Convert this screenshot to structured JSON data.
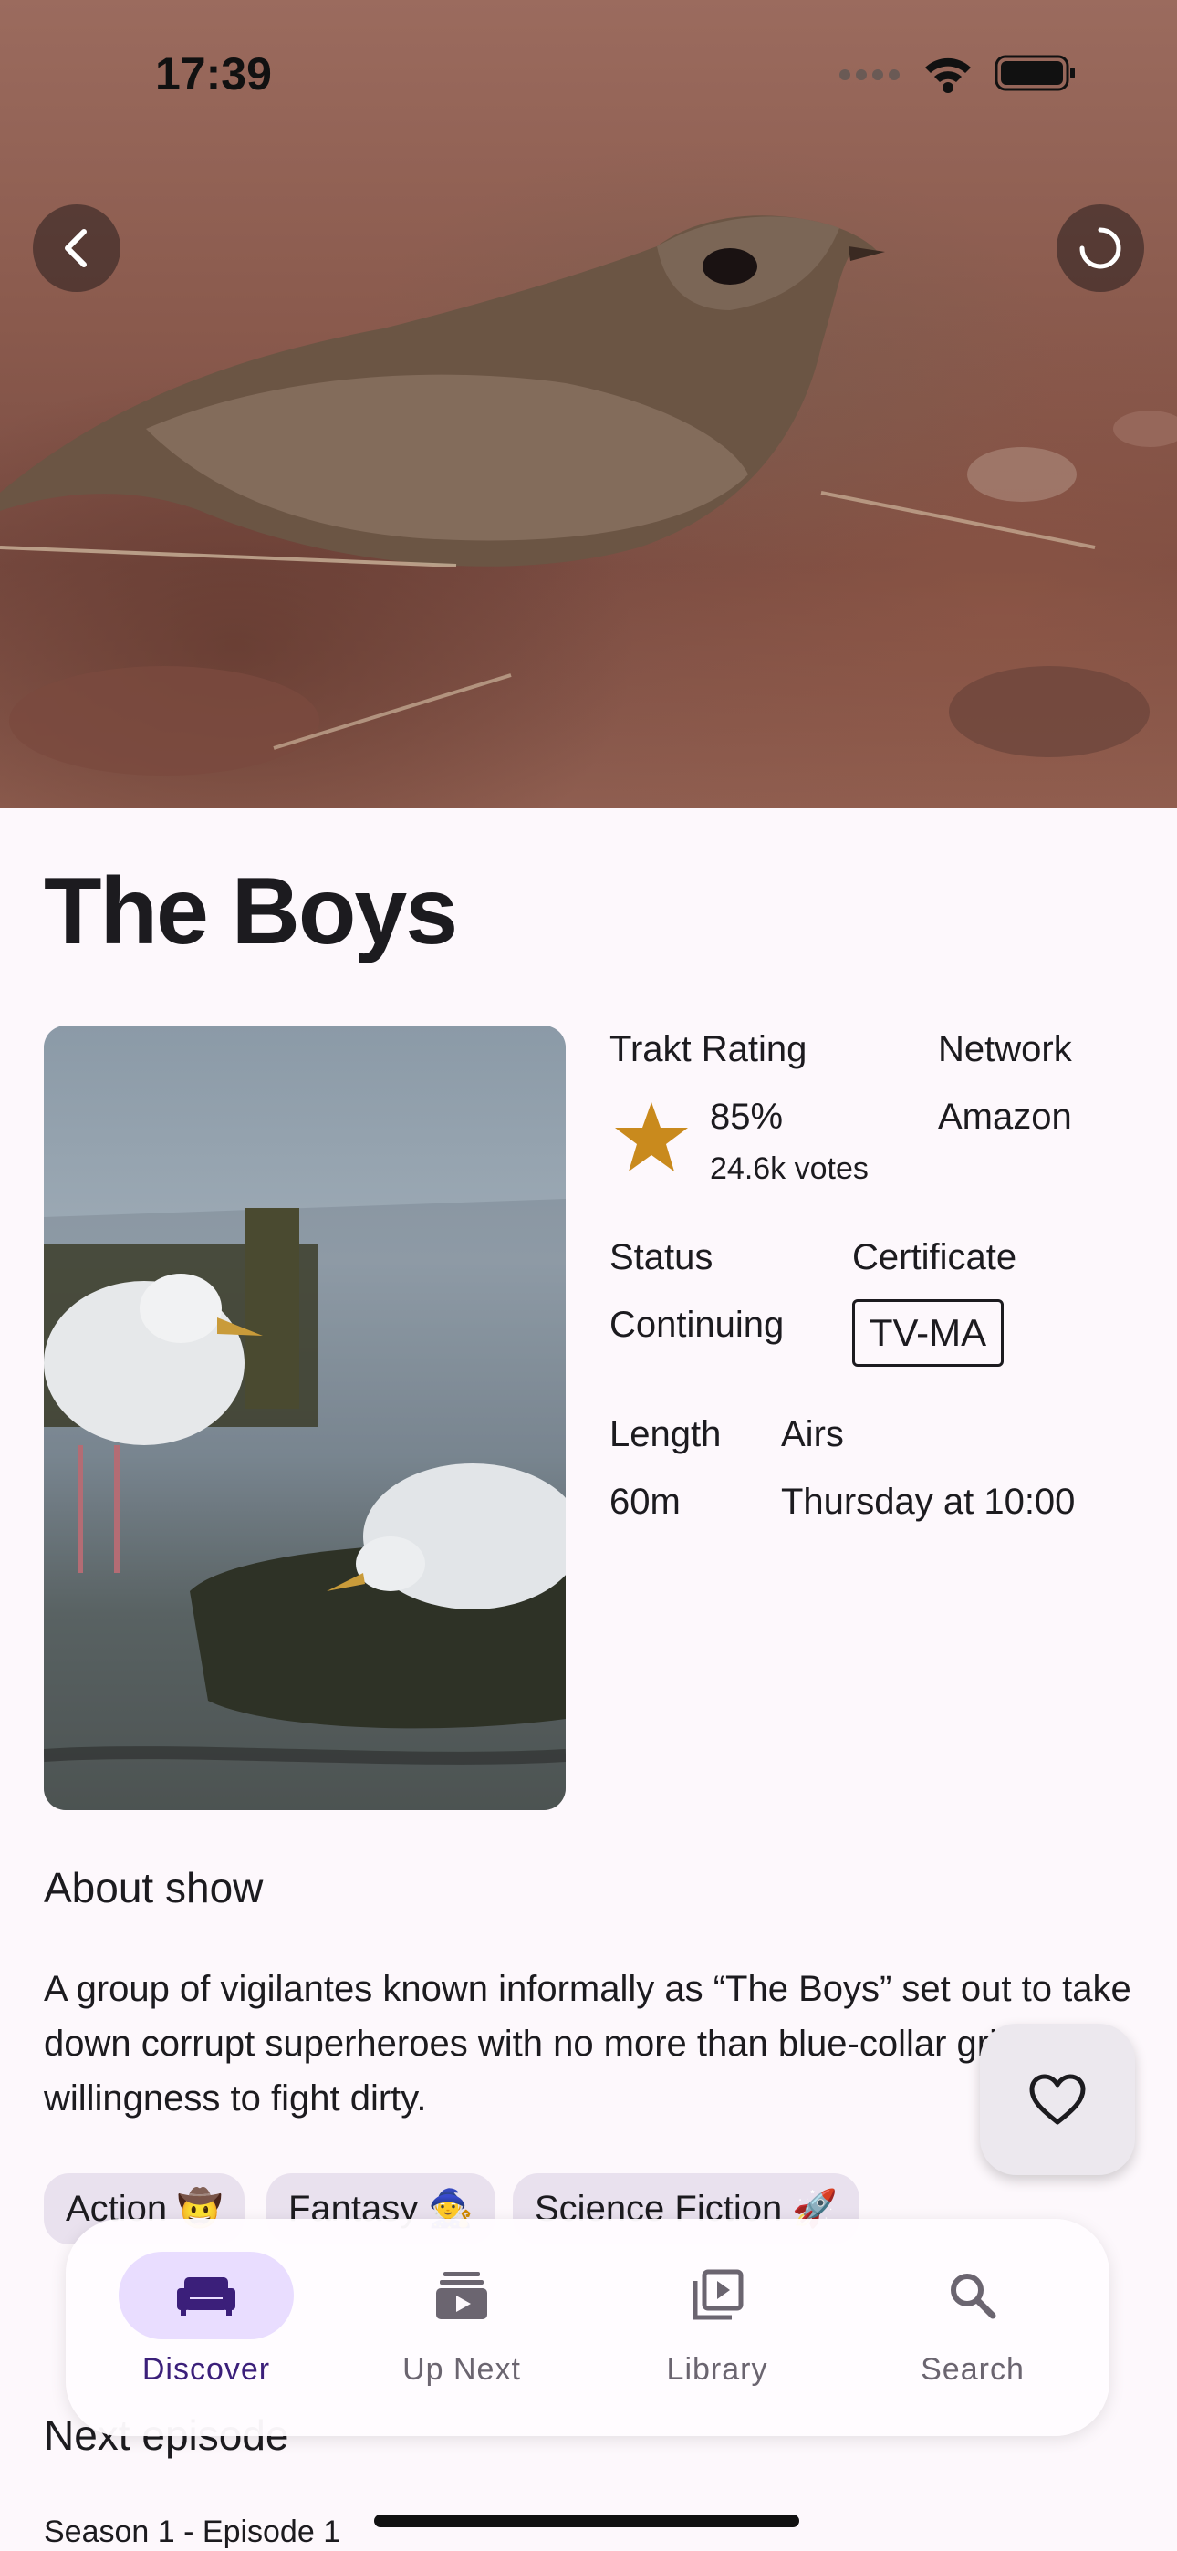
{
  "status_bar": {
    "time": "17:39"
  },
  "header": {
    "title": "The Boys"
  },
  "info": {
    "trakt_rating_label": "Trakt Rating",
    "rating_value": "85%",
    "votes": "24.6k votes",
    "network_label": "Network",
    "network_value": "Amazon",
    "status_label": "Status",
    "status_value": "Continuing",
    "certificate_label": "Certificate",
    "certificate_value": "TV-MA",
    "length_label": "Length",
    "length_value": "60m",
    "airs_label": "Airs",
    "airs_value": "Thursday at 10:00"
  },
  "about": {
    "heading": "About show",
    "description": "A group of vigilantes known informally as “The Boys” set out to take down corrupt superheroes with no more than blue-collar grit and a willingness to fight dirty."
  },
  "genres": [
    {
      "label": "Action 🤠"
    },
    {
      "label": "Fantasy 🧙"
    },
    {
      "label": "Science Fiction 🚀"
    }
  ],
  "next_episode": {
    "heading": "Next episode",
    "episode": "Season 1 - Episode 1"
  },
  "bottom_nav": {
    "items": [
      {
        "label": "Discover",
        "icon": "sofa-icon",
        "active": true
      },
      {
        "label": "Up Next",
        "icon": "video-stack-icon",
        "active": false
      },
      {
        "label": "Library",
        "icon": "video-library-icon",
        "active": false
      },
      {
        "label": "Search",
        "icon": "search-icon",
        "active": false
      }
    ]
  },
  "colors": {
    "accent": "#3b1f7a",
    "star": "#c98a1d",
    "background": "#fdf8fc"
  }
}
